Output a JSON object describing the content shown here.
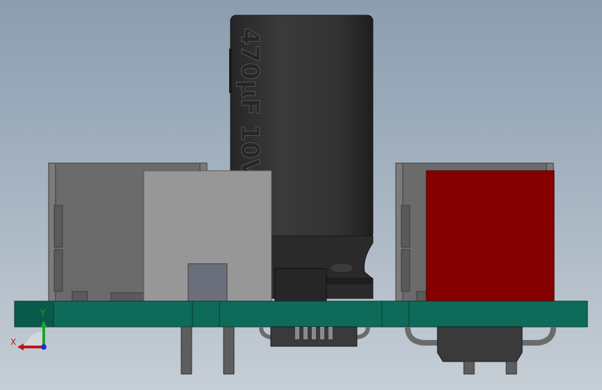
{
  "model": {
    "capacitor_marking": "470µF 10V",
    "colors": {
      "background_top": "#8b9db0",
      "background_bottom": "#c6ced6",
      "pcb": "#0e6b5a",
      "capacitor": "#2f2f2f",
      "connector_red": "#850000",
      "connector_grey": "#6b6b6b",
      "block_light": "#979797",
      "ic_dark": "#262626",
      "chip_blue": "#6b6f7c"
    }
  },
  "triad": {
    "x_label": "X",
    "y_label": "Y",
    "x_color": "#c0141b",
    "y_color": "#19a431",
    "z_color": "#1f2fd1"
  }
}
